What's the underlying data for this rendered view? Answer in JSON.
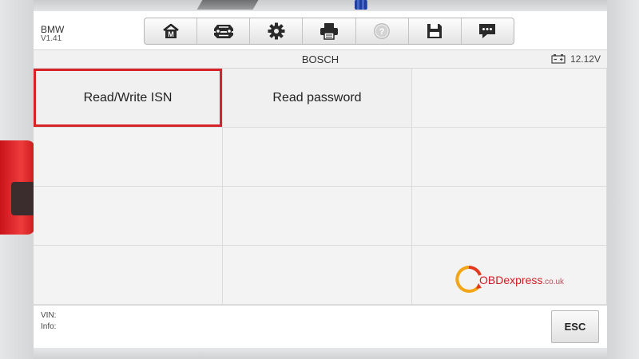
{
  "vehicle": {
    "name": "BMW",
    "version": "V1.41"
  },
  "toolbar": {
    "items": [
      {
        "icon": "home-icon",
        "glyph": "M"
      },
      {
        "icon": "vehicle-swap-icon"
      },
      {
        "icon": "gear-icon"
      },
      {
        "icon": "printer-icon"
      },
      {
        "icon": "help-icon",
        "glyph": "?"
      },
      {
        "icon": "save-icon"
      },
      {
        "icon": "message-icon"
      }
    ]
  },
  "titlebar": {
    "title": "BOSCH",
    "battery_icon": "battery-icon",
    "voltage": "12.12V"
  },
  "grid": {
    "items": [
      {
        "label": "Read/Write ISN",
        "selected": true
      },
      {
        "label": "Read password",
        "selected": false
      }
    ]
  },
  "watermark": {
    "brand": "OBDexpress",
    "domain": ".co.uk"
  },
  "bottom": {
    "vin_label": "VIN:",
    "info_label": "Info:",
    "esc_label": "ESC"
  },
  "colors": {
    "selection_border": "#d6232a",
    "grid_bg": "#f0f0f0",
    "watermark": "#d11c22"
  }
}
